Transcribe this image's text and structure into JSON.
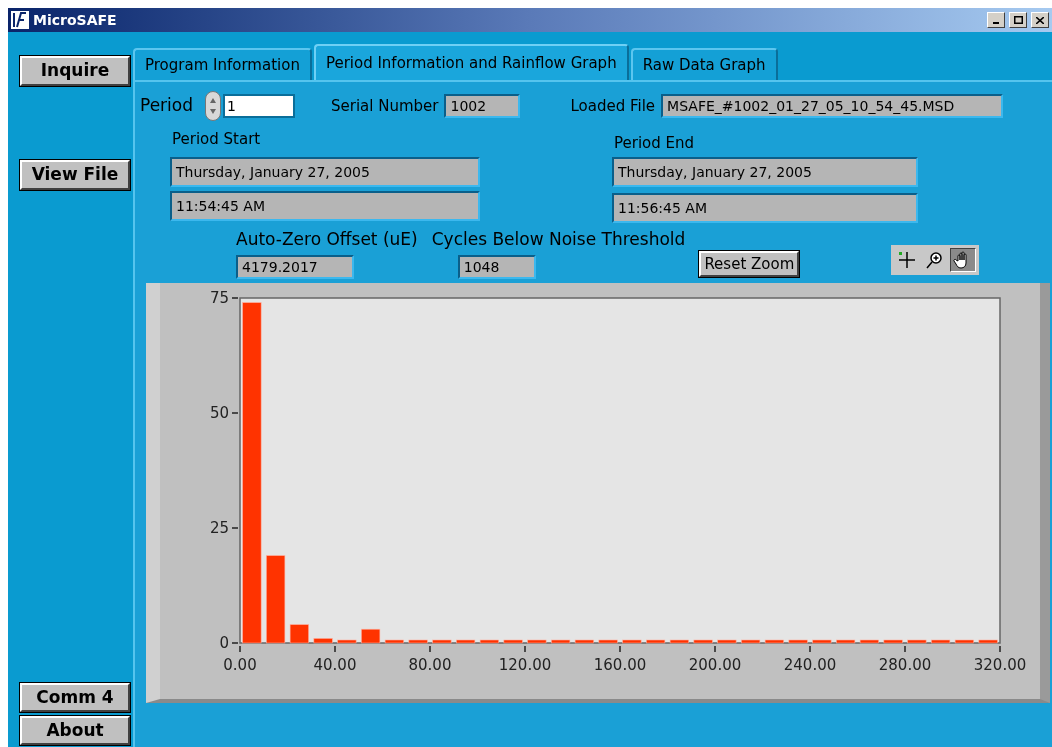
{
  "window": {
    "title": "MicroSAFE"
  },
  "side_buttons": [
    {
      "label": "Inquire"
    },
    {
      "label": "View File"
    }
  ],
  "bottom_buttons": [
    {
      "label": "Comm 4"
    },
    {
      "label": "About"
    }
  ],
  "tabs": [
    {
      "label": "Program Information",
      "selected": false
    },
    {
      "label": "Period Information and Rainflow Graph",
      "selected": true
    },
    {
      "label": "Raw Data Graph",
      "selected": false
    }
  ],
  "period": {
    "label": "Period",
    "value": "1"
  },
  "serial_number": {
    "label": "Serial Number",
    "value": "1002"
  },
  "loaded_file": {
    "label": "Loaded File",
    "value": "MSAFE_#1002_01_27_05_10_54_45.MSD"
  },
  "period_start": {
    "label": "Period Start",
    "date": "Thursday, January 27, 2005",
    "time": "11:54:45 AM"
  },
  "period_end": {
    "label": "Period End",
    "date": "Thursday, January 27, 2005",
    "time": "11:56:45 AM"
  },
  "auto_zero_offset": {
    "label": "Auto-Zero Offset (uE)",
    "value": "4179.2017"
  },
  "cycles_below_noise": {
    "label": "Cycles Below Noise Threshold",
    "value": "1048"
  },
  "reset_zoom": {
    "label": "Reset Zoom"
  },
  "graph_tools": [
    {
      "kind": "cursor",
      "selected": false
    },
    {
      "kind": "zoom",
      "selected": false
    },
    {
      "kind": "pan",
      "selected": true
    }
  ],
  "chart_data": {
    "type": "bar",
    "xlim": [
      0,
      320
    ],
    "ylim": [
      0,
      75
    ],
    "xticks": [
      {
        "value": 0,
        "label": "0.00"
      },
      {
        "value": 40,
        "label": "40.00"
      },
      {
        "value": 80,
        "label": "80.00"
      },
      {
        "value": 120,
        "label": "120.00"
      },
      {
        "value": 160,
        "label": "160.00"
      },
      {
        "value": 200,
        "label": "200.00"
      },
      {
        "value": 240,
        "label": "240.00"
      },
      {
        "value": 280,
        "label": "280.00"
      },
      {
        "value": 320,
        "label": "320.00"
      }
    ],
    "yticks": [
      0,
      25,
      50,
      75
    ],
    "x": [
      5,
      15,
      25,
      35,
      45,
      55,
      65,
      75,
      85,
      95,
      105,
      115,
      125,
      135,
      145,
      155,
      165,
      175,
      185,
      195,
      205,
      215,
      225,
      235,
      245,
      255,
      265,
      275,
      285,
      295,
      305,
      315
    ],
    "series": [
      {
        "color": "#ff3300",
        "values": [
          74,
          19,
          4,
          1,
          0,
          3,
          0,
          0,
          0,
          0,
          0,
          0,
          0,
          0,
          0,
          0,
          0,
          0,
          0,
          0,
          0,
          0,
          0,
          0,
          0,
          0,
          0,
          0,
          0,
          0,
          0,
          0
        ]
      }
    ]
  }
}
